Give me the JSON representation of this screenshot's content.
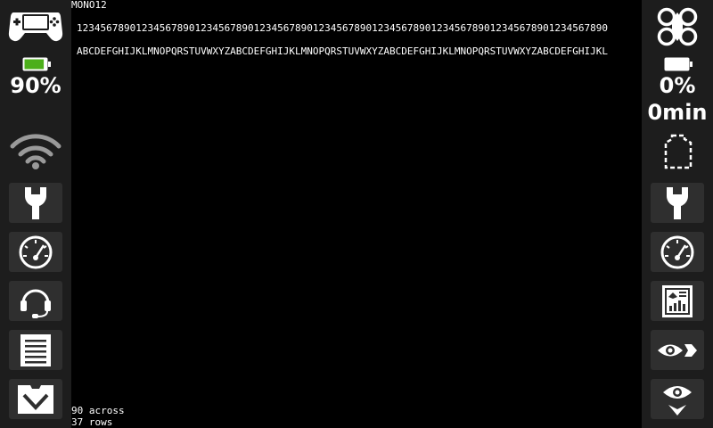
{
  "screen": {
    "font_title": "MONO12",
    "digits_line": "123456789012345678901234567890123456789012345678901234567890123456789012345678901234567890",
    "letters_line": "ABCDEFGHIJKLMNOPQRSTUVWXYZABCDEFGHIJKLMNOPQRSTUVWXYZABCDEFGHIJKLMNOPQRSTUVWXYZABCDEFGHIJKL",
    "across_text": "90 across",
    "rows_text": "37 rows"
  },
  "left_panel": {
    "device_icon": "gamepad-icon",
    "battery_icon": "battery-icon",
    "battery_percent": "90%",
    "battery_level": 0.9,
    "battery_color": "#4caf1a",
    "signal_icon": "wifi-icon",
    "buttons": [
      {
        "icon": "wrench-icon"
      },
      {
        "icon": "gauge-icon"
      },
      {
        "icon": "headset-icon"
      },
      {
        "icon": "document-icon"
      },
      {
        "icon": "chevron-down-icon"
      }
    ]
  },
  "right_panel": {
    "device_icon": "drone-icon",
    "battery_icon": "battery-icon",
    "battery_percent": "0%",
    "battery_level": 0,
    "flight_time": "0min",
    "status_icon": "dashed-shape-icon",
    "buttons": [
      {
        "icon": "wrench-icon"
      },
      {
        "icon": "gauge-icon"
      },
      {
        "icon": "telemetry-icon"
      },
      {
        "icon": "eye-arrow-icon"
      },
      {
        "icon": "eye-down-icon"
      }
    ]
  }
}
